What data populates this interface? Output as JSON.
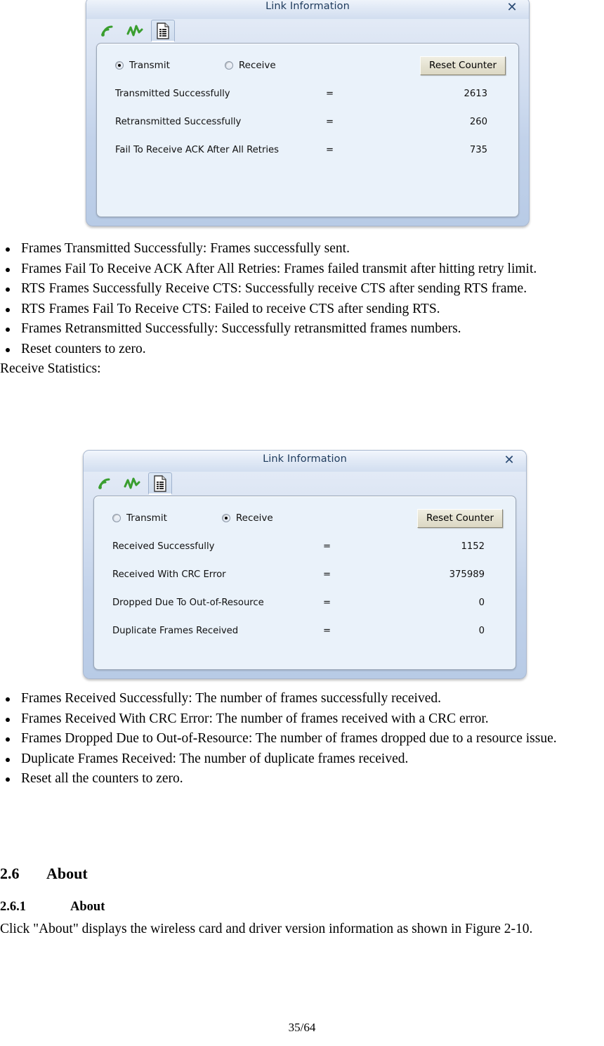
{
  "page": {
    "footer": "35/64"
  },
  "dialog_transmit": {
    "title": "Link Information",
    "close_label": "✕",
    "icons": [
      "wifi-signal-icon",
      "activity-graph-icon",
      "statistics-page-icon"
    ],
    "radios": [
      {
        "label": "Transmit",
        "checked": true
      },
      {
        "label": "Receive",
        "checked": false
      }
    ],
    "reset_button": "Reset Counter",
    "eq": "=",
    "rows": [
      {
        "label": "Transmitted Successfully",
        "value": "2613"
      },
      {
        "label": "Retransmitted Successfully",
        "value": "260"
      },
      {
        "label": "Fail To Receive ACK After All Retries",
        "value": "735"
      }
    ]
  },
  "transmit_bullets": [
    "Frames Transmitted Successfully: Frames successfully sent.",
    "Frames Fail To Receive ACK After All Retries: Frames failed transmit after hitting retry limit.",
    "RTS Frames Successfully Receive CTS: Successfully receive CTS after sending RTS frame.",
    "RTS Frames Fail To Receive CTS: Failed to receive CTS after sending RTS.",
    "Frames Retransmitted Successfully: Successfully retransmitted frames numbers.",
    "Reset counters to zero."
  ],
  "receive_caption": "Receive Statistics:",
  "dialog_receive": {
    "title": "Link Information",
    "close_label": "✕",
    "icons": [
      "wifi-signal-icon",
      "activity-graph-icon",
      "statistics-page-icon"
    ],
    "radios": [
      {
        "label": "Transmit",
        "checked": false
      },
      {
        "label": "Receive",
        "checked": true
      }
    ],
    "reset_button": "Reset Counter",
    "eq": "=",
    "rows": [
      {
        "label": "Received Successfully",
        "value": "1152"
      },
      {
        "label": "Received With CRC Error",
        "value": "375989"
      },
      {
        "label": "Dropped Due To Out-of-Resource",
        "value": "0"
      },
      {
        "label": "Duplicate Frames Received",
        "value": "0"
      }
    ]
  },
  "receive_bullets": [
    "Frames Received Successfully: The number of frames successfully received.",
    "Frames Received With CRC Error: The number of frames received with a CRC error.",
    "Frames Dropped Due to Out-of-Resource: The number of frames dropped due to a resource issue.",
    "Duplicate Frames Received: The number of duplicate frames received.",
    "Reset all the counters to zero."
  ],
  "about_section": {
    "heading_number": "2.6",
    "heading_title": "About",
    "sub_number": "2.6.1",
    "sub_title": "About",
    "body": "Click \"About\" displays the wireless card and driver version information as shown in Figure 2-10."
  },
  "colors": {
    "accent_red": "#c00c1e",
    "title_blue": "#1d3a5c",
    "icon_green": "#3a9e2f",
    "panel_bg": "#eaf2fa"
  }
}
